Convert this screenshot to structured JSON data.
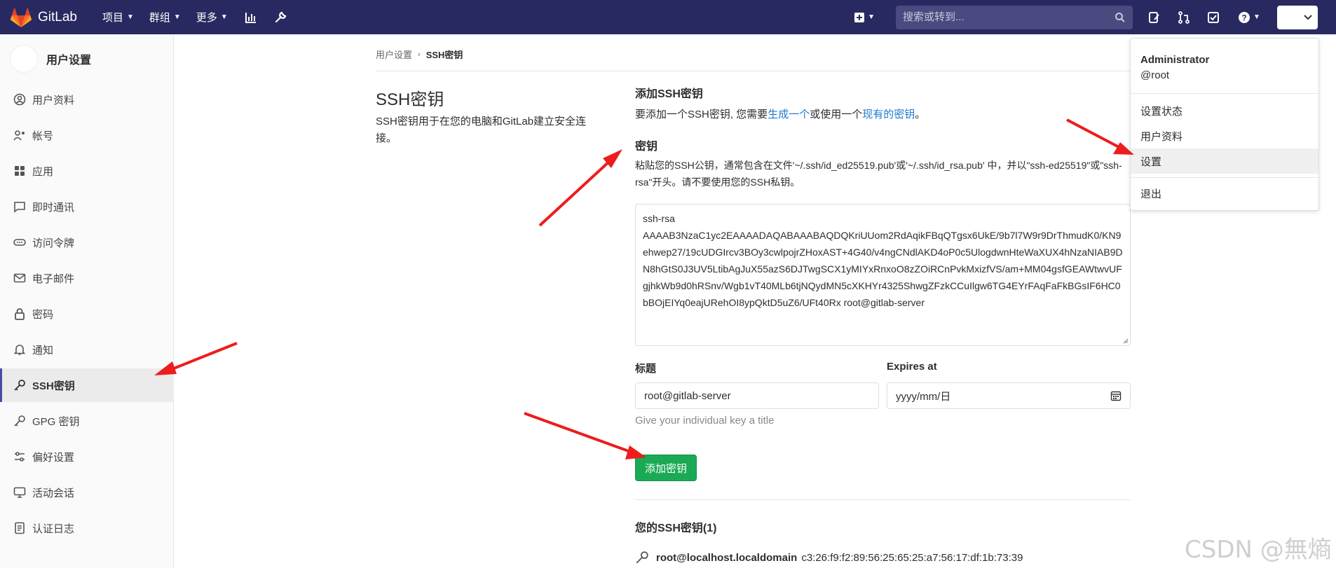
{
  "colors": {
    "navbar": "#292961",
    "accent": "#1aaa55",
    "link": "#1f78d1",
    "arrow": "#ee1c1c"
  },
  "navbar": {
    "brand": "GitLab",
    "menus": [
      {
        "label": "项目"
      },
      {
        "label": "群组"
      },
      {
        "label": "更多"
      }
    ],
    "search_placeholder": "搜索或转到..."
  },
  "sidebar": {
    "title": "用户设置",
    "items": [
      {
        "label": "用户资料",
        "icon": "user-circle-icon"
      },
      {
        "label": "帐号",
        "icon": "account-gear-icon"
      },
      {
        "label": "应用",
        "icon": "grid-icon"
      },
      {
        "label": "即时通讯",
        "icon": "chat-icon"
      },
      {
        "label": "访问令牌",
        "icon": "token-icon"
      },
      {
        "label": "电子邮件",
        "icon": "mail-icon"
      },
      {
        "label": "密码",
        "icon": "lock-icon"
      },
      {
        "label": "通知",
        "icon": "bell-icon"
      },
      {
        "label": "SSH密钥",
        "icon": "key-icon"
      },
      {
        "label": "GPG 密钥",
        "icon": "key-icon"
      },
      {
        "label": "偏好设置",
        "icon": "sliders-icon"
      },
      {
        "label": "活动会话",
        "icon": "monitor-icon"
      },
      {
        "label": "认证日志",
        "icon": "log-icon"
      }
    ]
  },
  "breadcrumb": {
    "parent": "用户设置",
    "current": "SSH密钥"
  },
  "section": {
    "title": "SSH密钥",
    "description": "SSH密钥用于在您的电脑和GitLab建立安全连接。"
  },
  "form": {
    "add_title": "添加SSH密钥",
    "add_desc_prefix": "要添加一个SSH密钥, 您需要",
    "add_desc_link1": "生成一个",
    "add_desc_mid": "或使用一个",
    "add_desc_link2": "现有的密钥",
    "add_desc_suffix": "。",
    "key_label": "密钥",
    "key_desc": "粘贴您的SSH公钥，通常包含在文件'~/.ssh/id_ed25519.pub'或'~/.ssh/id_rsa.pub' 中，并以\"ssh-ed25519\"或\"ssh-rsa\"开头。请不要使用您的SSH私钥。",
    "key_value": "ssh-rsa\nAAAAB3NzaC1yc2EAAAADAQABAAABAQDQKriUUom2RdAqikFBqQTgsx6UkE/9b7l7W9r9DrThmudK0/KN9ehwep27/19cUDGIrcv3BOy3cwlpojrZHoxAST+4G40/v4ngCNdlAKD4oP0c5UlogdwnHteWaXUX4hNzaNIAB9DN8hGtS0J3UV5LtibAgJuX55azS6DJTwgSCX1yMIYxRnxoO8zZOiRCnPvkMxizfVS/am+MM04gsfGEAWtwvUFgjhkWb9d0hRSnv/Wgb1vT40MLb6tjNQydMN5cXKHYr4325ShwgZFzkCCuIlgw6TG4EYrFAqFaFkBGsIF6HC0bBOjEIYq0eajURehOI8ypQktD5uZ6/UFt40Rx root@gitlab-server",
    "title_label": "标题",
    "title_value": "root@gitlab-server",
    "expires_label": "Expires at",
    "expires_placeholder": "yyyy/mm/日",
    "hint": "Give your individual key a title",
    "submit_label": "添加密钥"
  },
  "keys": {
    "heading": "您的SSH密钥(1)",
    "items": [
      {
        "name": "root@localhost.localdomain",
        "fingerprint": "c3:26:f9:f2:89:56:25:65:25:a7:56:17:df:1b:73:39"
      }
    ]
  },
  "user_menu": {
    "name": "Administrator",
    "username": "@root",
    "items": [
      {
        "label": "设置状态"
      },
      {
        "label": "用户资料"
      },
      {
        "label": "设置"
      },
      {
        "label": "退出"
      }
    ]
  },
  "watermark": "CSDN @無熵"
}
